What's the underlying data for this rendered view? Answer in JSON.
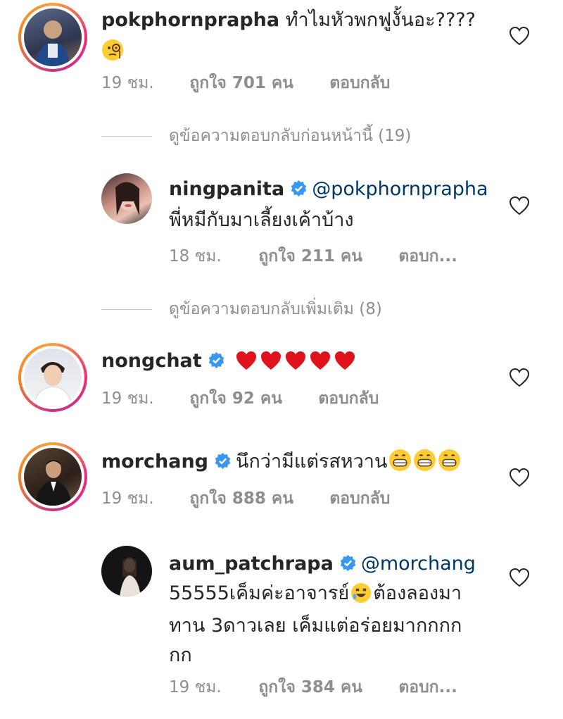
{
  "comments": [
    {
      "username": "pokphornprapha",
      "text_line1": "ทำไมหัวพกฟูงั้นอะ????",
      "emoji": "monocle-face",
      "time": "19 ชม.",
      "likes": "ถูกใจ 701 คน",
      "reply": "ตอบกลับ"
    },
    {
      "view_replies": "ดูข้อความตอบกลับก่อนหน้านี้ (19)"
    },
    {
      "username": "ningpanita",
      "mention": "@pokphornprapha",
      "text": "พี่หมีกับมาเลี้ยงเค้าบ้าง",
      "time": "18 ชม.",
      "likes": "ถูกใจ 211 คน",
      "reply": "ตอบก..."
    },
    {
      "view_replies": "ดูข้อความตอบกลับเพิ่มเติม (8)"
    },
    {
      "username": "nongchat",
      "hearts": 5,
      "time": "19 ชม.",
      "likes": "ถูกใจ 92 คน",
      "reply": "ตอบกลับ"
    },
    {
      "username": "morchang",
      "text": "นึกว่ามีแต่รสหวาน",
      "emoji_count": 3,
      "time": "19 ชม.",
      "likes": "ถูกใจ 888 คน",
      "reply": "ตอบกลับ"
    },
    {
      "username": "aum_patchrapa",
      "mention": "@morchang",
      "text_line1_a": "55555เค็มค่ะอาจารย์",
      "text_line1_b": "ต้องลองมา",
      "text_line2": "ทาน 3ดาวเลย เค็มแต่อร่อยมากกกก",
      "text_line3": "กก",
      "time": "19 ชม.",
      "likes": "ถูกใจ 384 คน",
      "reply": "ตอบก..."
    }
  ],
  "colors": {
    "text": "#262626",
    "meta": "#8e8e8e",
    "mention": "#00376b",
    "verified": "#3897f0",
    "heart_red": "#e0121b"
  }
}
